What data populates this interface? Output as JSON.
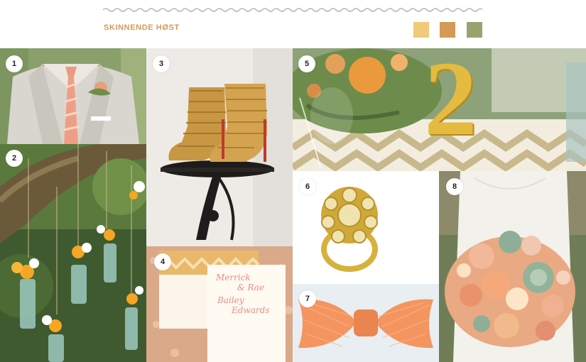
{
  "header": {
    "title": "SKINNENDE HØST",
    "palette": [
      "#f1c979",
      "#d49a57",
      "#97a36d"
    ]
  },
  "tiles": [
    {
      "number": "1",
      "subject": "suit-boutonniere"
    },
    {
      "number": "2",
      "subject": "hanging-bottle-flowers"
    },
    {
      "number": "3",
      "subject": "gold-ankle-boots"
    },
    {
      "number": "4",
      "subject": "invitation-cards"
    },
    {
      "number": "5",
      "subject": "table-number-centerpiece"
    },
    {
      "number": "6",
      "subject": "gold-ring"
    },
    {
      "number": "7",
      "subject": "coral-bow-tie"
    },
    {
      "number": "8",
      "subject": "bridal-bouquet"
    }
  ],
  "invitation": {
    "line1": "Merrick",
    "line2": "& Rae",
    "line3": "Bailey",
    "line4": "Edwards"
  },
  "table_number": "2"
}
